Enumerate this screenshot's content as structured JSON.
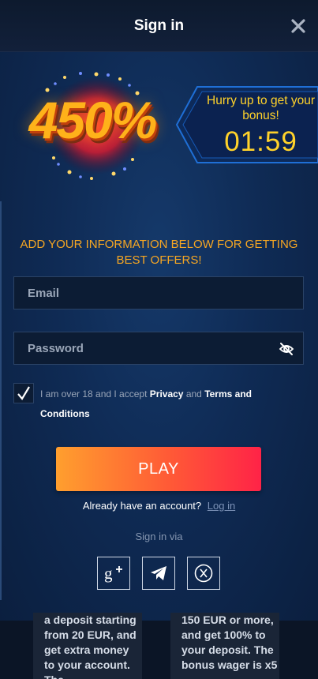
{
  "header": {
    "title": "Sign in"
  },
  "bonus": {
    "percent": "450%"
  },
  "timer": {
    "label": "Hurry up to get your bonus!",
    "value": "01:59"
  },
  "promo": {
    "text": "ADD YOUR INFORMATION BELOW FOR GETTING BEST OFFERS!"
  },
  "form": {
    "email_placeholder": "Email",
    "password_placeholder": "Password",
    "terms_prefix": "I am over 18 and I accept",
    "terms_privacy": "Privacy",
    "terms_and": "and",
    "terms_conditions": "Terms and Conditions",
    "checked": true
  },
  "play": {
    "label": "PLAY"
  },
  "account": {
    "text": "Already have an account?",
    "login": "Log in"
  },
  "social": {
    "title": "Sign in via",
    "items": [
      "google-plus-icon",
      "telegram-icon",
      "x-icon"
    ]
  },
  "bonus_cards": [
    {
      "text": "a deposit starting from 20 EUR, and get extra money to your account. The"
    },
    {
      "text": "150 EUR or more, and get 100% to your deposit. The bonus wager is x5"
    }
  ],
  "colors": {
    "accent": "#f5a623",
    "timer": "#ffd22a",
    "button_start": "#ff9f2e",
    "button_end": "#ff2347"
  }
}
